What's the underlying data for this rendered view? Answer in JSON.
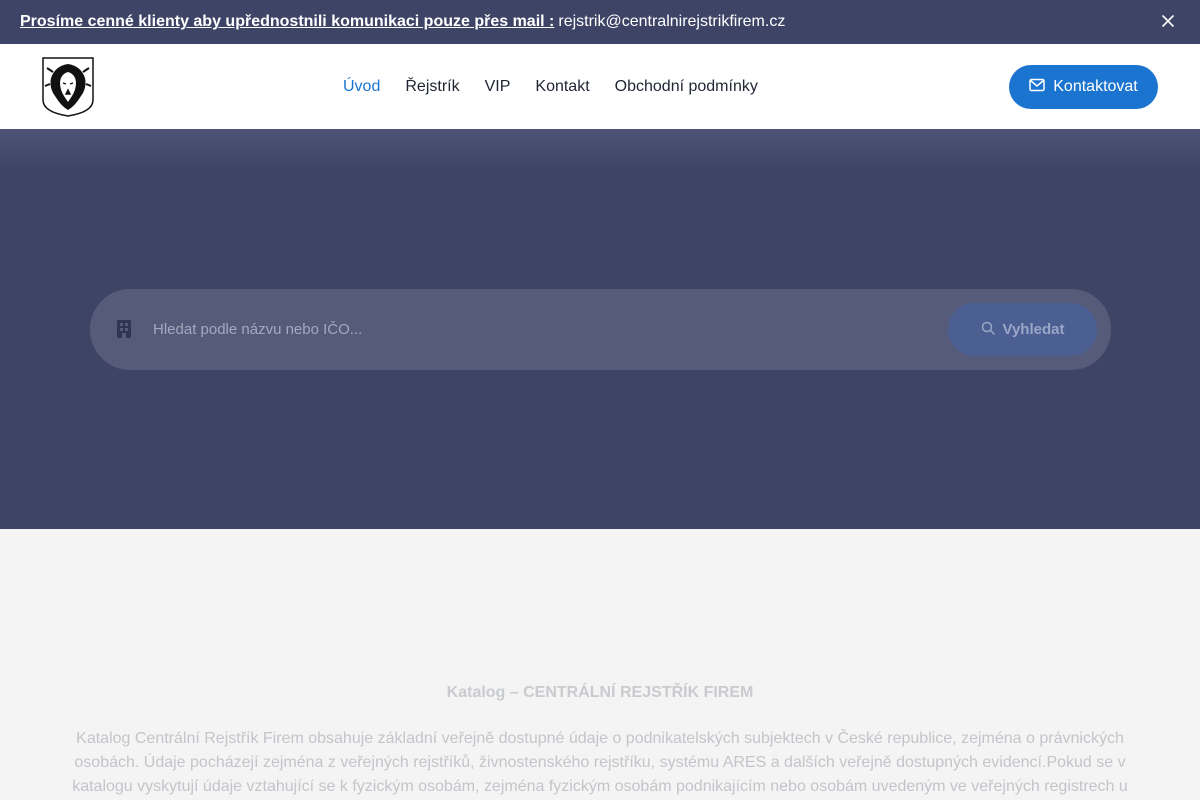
{
  "announcement": {
    "bold_text": "Prosíme cenné klienty aby upřednostnili komunikaci pouze přes mail :",
    "email": "rejstrik@centralnirejstrikfirem.cz",
    "close_icon": "close-icon"
  },
  "header": {
    "logo_icon": "lion-logo",
    "nav": [
      {
        "label": "Úvod",
        "active": true
      },
      {
        "label": "Řejstrík",
        "active": false
      },
      {
        "label": "VIP",
        "active": false
      },
      {
        "label": "Kontakt",
        "active": false
      },
      {
        "label": "Obchodní podmínky",
        "active": false
      }
    ],
    "cta_label": "Kontaktovat",
    "cta_icon": "mail-icon"
  },
  "search": {
    "placeholder": "Hledat podle názvu nebo IČO...",
    "value": "",
    "field_icon": "building-icon",
    "button_label": "Vyhledat",
    "button_icon": "search-icon"
  },
  "content": {
    "heading": "Katalog – CENTRÁLNÍ REJSTŘÍK FIREM",
    "paragraph": "Katalog Centrální Rejstřík Firem obsahuje základní veřejně dostupné údaje o podnikatelských subjektech v České republice, zejména o právnických osobách. Údaje pocházejí zejména z veřejných rejstříků, živnostenského rejstříku, systému ARES a dalších veřejně dostupných evidencí.Pokud se v katalogu vyskytují údaje vztahující se k fyzickým osobám, zejména fyzickým osobám podnikajícím nebo osobám uvedeným ve veřejných registrech u"
  },
  "colors": {
    "dark_bar": "#3e4466",
    "accent": "#1c74d1",
    "search_bg": "#555b79",
    "page_bg": "#f3f4f3"
  }
}
